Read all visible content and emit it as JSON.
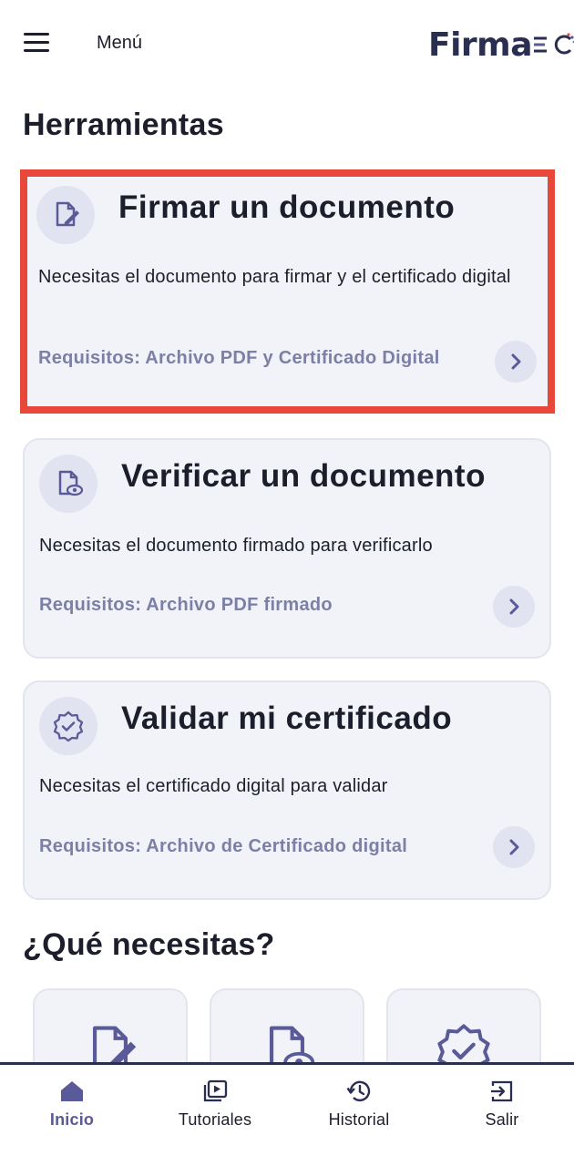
{
  "header": {
    "menu_label": "Menú",
    "logo_text": "Firma",
    "logo_suffix": "EC"
  },
  "tools": {
    "title": "Herramientas",
    "cards": [
      {
        "icon": "document-sign-icon",
        "title": "Firmar un documento",
        "description": "Necesitas el documento para firmar y el certificado digital",
        "requirements": "Requisitos: Archivo PDF y Certificado Digital",
        "highlighted": true
      },
      {
        "icon": "document-verify-icon",
        "title": "Verificar un documento",
        "description": "Necesitas el documento firmado para verificarlo",
        "requirements": "Requisitos: Archivo PDF firmado",
        "highlighted": false
      },
      {
        "icon": "certificate-badge-icon",
        "title": "Validar mi certificado",
        "description": "Necesitas el certificado digital para validar",
        "requirements": "Requisitos: Archivo de Certificado digital",
        "highlighted": false
      }
    ]
  },
  "needs": {
    "title": "¿Qué necesitas?",
    "items": [
      {
        "icon": "document-sign-icon"
      },
      {
        "icon": "document-verify-icon"
      },
      {
        "icon": "certificate-badge-icon"
      }
    ]
  },
  "bottom_nav": {
    "items": [
      {
        "label": "Inicio",
        "icon": "home-icon",
        "active": true
      },
      {
        "label": "Tutoriales",
        "icon": "video-library-icon",
        "active": false
      },
      {
        "label": "Historial",
        "icon": "history-icon",
        "active": false
      },
      {
        "label": "Salir",
        "icon": "logout-icon",
        "active": false
      }
    ]
  },
  "colors": {
    "accent": "#5a5a98",
    "highlight_border": "#e8483a",
    "card_background": "#f1f3f8",
    "requirements_text": "#7c7fa6"
  }
}
